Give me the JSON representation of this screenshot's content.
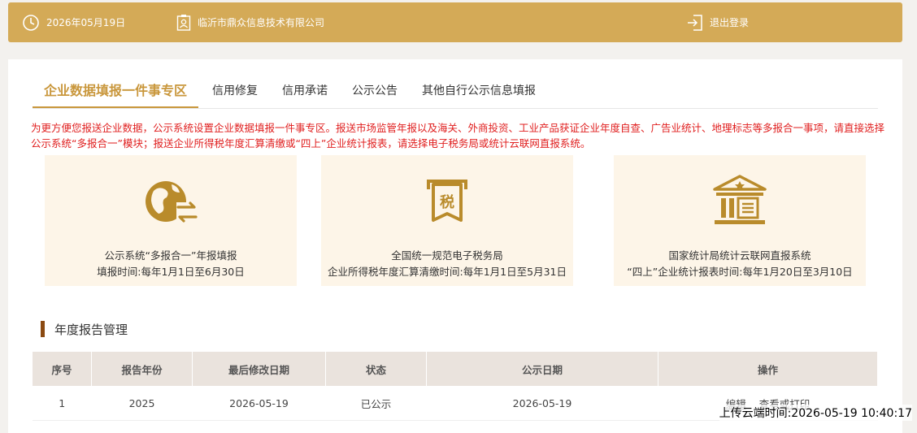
{
  "header": {
    "date": "2026年05月19日",
    "company": "临沂市鼎众信息技术有限公司",
    "logout": "退出登录"
  },
  "tabs": [
    {
      "label": "企业数据填报一件事专区"
    },
    {
      "label": "信用修复"
    },
    {
      "label": "信用承诺"
    },
    {
      "label": "公示公告"
    },
    {
      "label": "其他自行公示信息填报"
    }
  ],
  "notice": "为更方便您报送企业数据，公示系统设置企业数据填报一件事专区。报送市场监管年报以及海关、外商投资、工业产品获证企业年度自查、广告业统计、地理标志等多报合一事项，请直接选择公示系统“多报合一”模块；报送企业所得税年度汇算清缴或“四上”企业统计报表，请选择电子税务局或统计云联网直报系统。",
  "cards": [
    {
      "line1": "公示系统“多报合一”年报填报",
      "line2": "填报时间:每年1月1日至6月30日",
      "icon": "globe-exchange-icon"
    },
    {
      "line1": "全国统一规范电子税务局",
      "line2": "企业所得税年度汇算清缴时间:每年1月1日至5月31日",
      "icon": "tax-icon",
      "icon_text": "税"
    },
    {
      "line1": "国家统计局统计云联网直报系统",
      "line2": "“四上”企业统计报表时间:每年1月20日至3月10日",
      "icon": "government-building-icon"
    }
  ],
  "section_title": "年度报告管理",
  "table": {
    "headers": [
      "序号",
      "报告年份",
      "最后修改日期",
      "状态",
      "公示日期",
      "操作"
    ],
    "rows": [
      {
        "index": "1",
        "year": "2025",
        "modified": "2026-05-19",
        "status": "已公示",
        "published": "2026-05-19",
        "action_edit": "编辑",
        "action_view": "查看或打印"
      }
    ]
  },
  "footer_stamp": "上传云端时间:2026-05-19 10:40:17",
  "colors": {
    "topbar": "#d4aa57",
    "accent": "#c9973c",
    "notice": "#e02020",
    "card_bg": "#fdf5e8",
    "icon": "#b98b2b",
    "section_bar": "#8b4a12"
  }
}
